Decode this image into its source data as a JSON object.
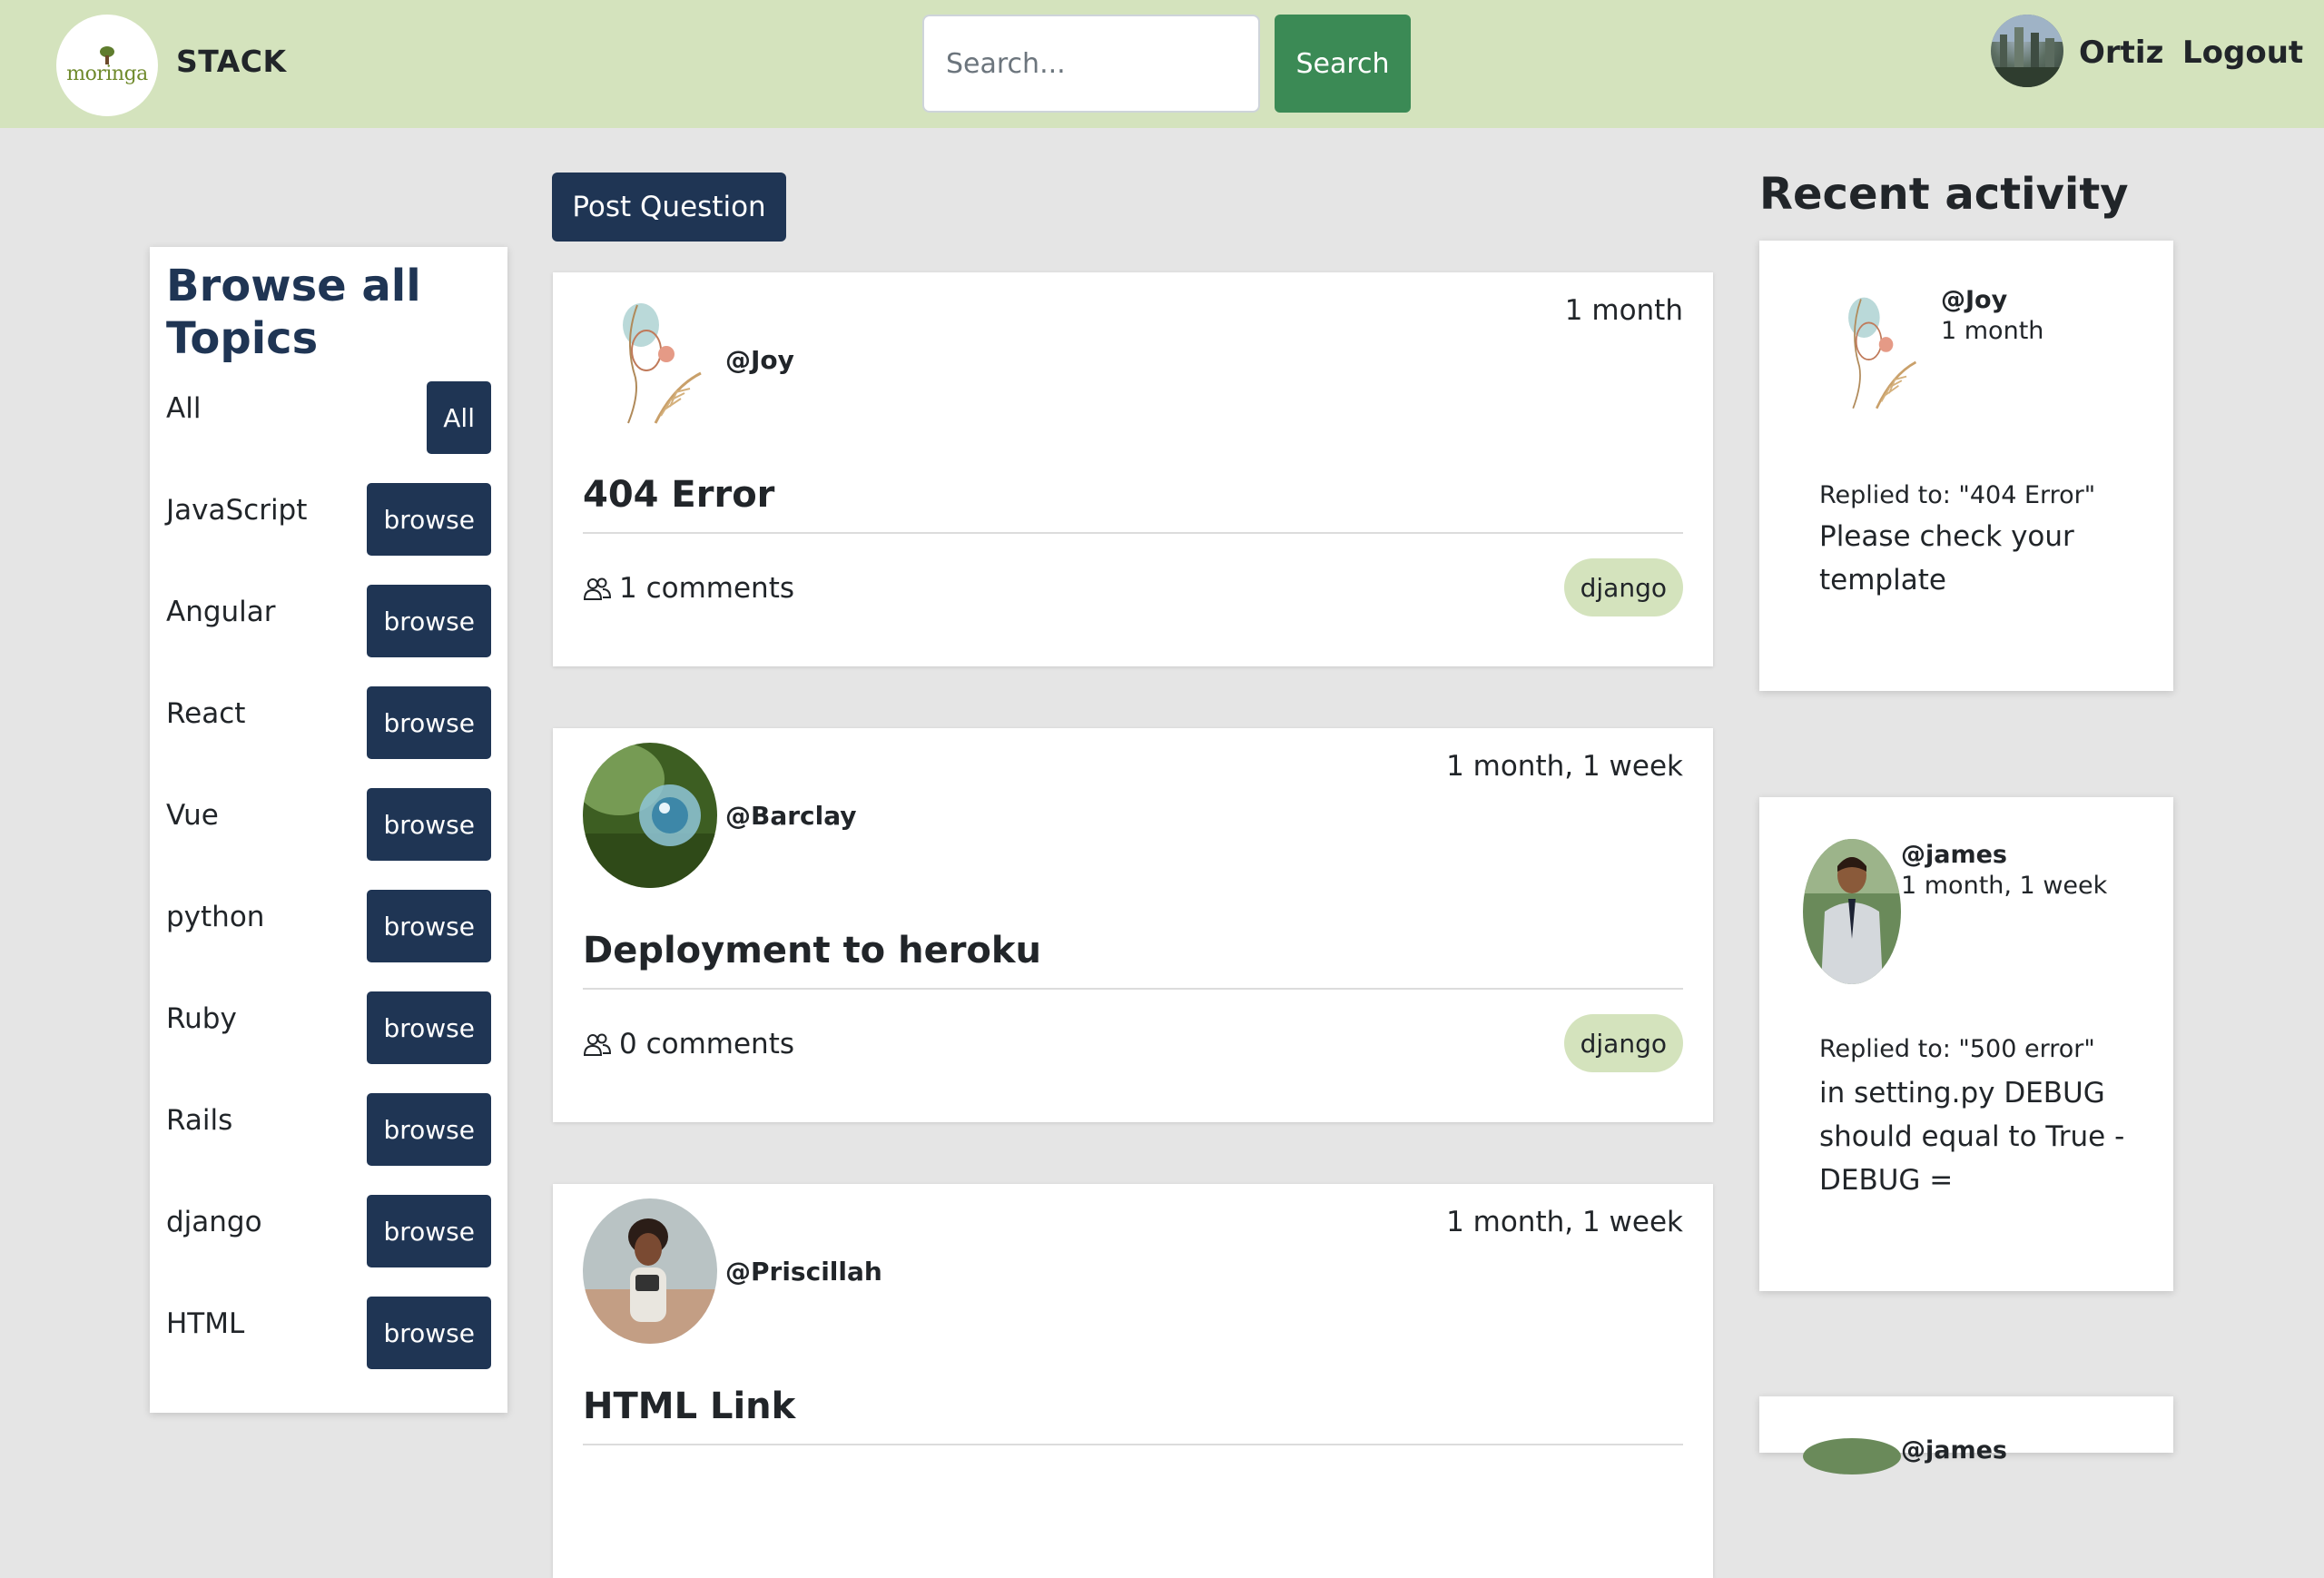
{
  "header": {
    "brand": "STACK",
    "logo_text": "moringa",
    "search_placeholder": "Search...",
    "search_button": "Search",
    "username": "Ortiz",
    "logout": "Logout"
  },
  "topics": {
    "title": "Browse all Topics",
    "items": [
      {
        "label": "All",
        "button": "All"
      },
      {
        "label": "JavaScript",
        "button": "browse"
      },
      {
        "label": "Angular",
        "button": "browse"
      },
      {
        "label": "React",
        "button": "browse"
      },
      {
        "label": "Vue",
        "button": "browse"
      },
      {
        "label": "python",
        "button": "browse"
      },
      {
        "label": "Ruby",
        "button": "browse"
      },
      {
        "label": "Rails",
        "button": "browse"
      },
      {
        "label": "django",
        "button": "browse"
      },
      {
        "label": "HTML",
        "button": "browse"
      }
    ]
  },
  "feed": {
    "post_button": "Post Question",
    "questions": [
      {
        "user": "@Joy",
        "time": "1 month",
        "title": "404 Error",
        "comments": "1 comments",
        "tag": "django"
      },
      {
        "user": "@Barclay",
        "time": "1 month, 1 week",
        "title": "Deployment to heroku",
        "comments": "0 comments",
        "tag": "django"
      },
      {
        "user": "@Priscillah",
        "time": "1 month, 1 week",
        "title": "HTML Link",
        "comments": "",
        "tag": ""
      }
    ]
  },
  "activity": {
    "title": "Recent activity",
    "items": [
      {
        "user": "@Joy",
        "time": "1 month",
        "replied": "Replied to: \"404 Error\"",
        "body": "Please check your template"
      },
      {
        "user": "@james",
        "time": "1 month, 1 week",
        "replied": "Replied to: \"500 error\"",
        "body": "in setting.py DEBUG should equal to True - DEBUG ="
      },
      {
        "user": "@james",
        "time": "",
        "replied": "",
        "body": ""
      }
    ]
  },
  "colors": {
    "navbar": "#d4e3bd",
    "primary_dark": "#1f3554",
    "search_green": "#3b8a55",
    "tag_bg": "#d4e3bd",
    "page_bg": "#e5e5e5"
  }
}
